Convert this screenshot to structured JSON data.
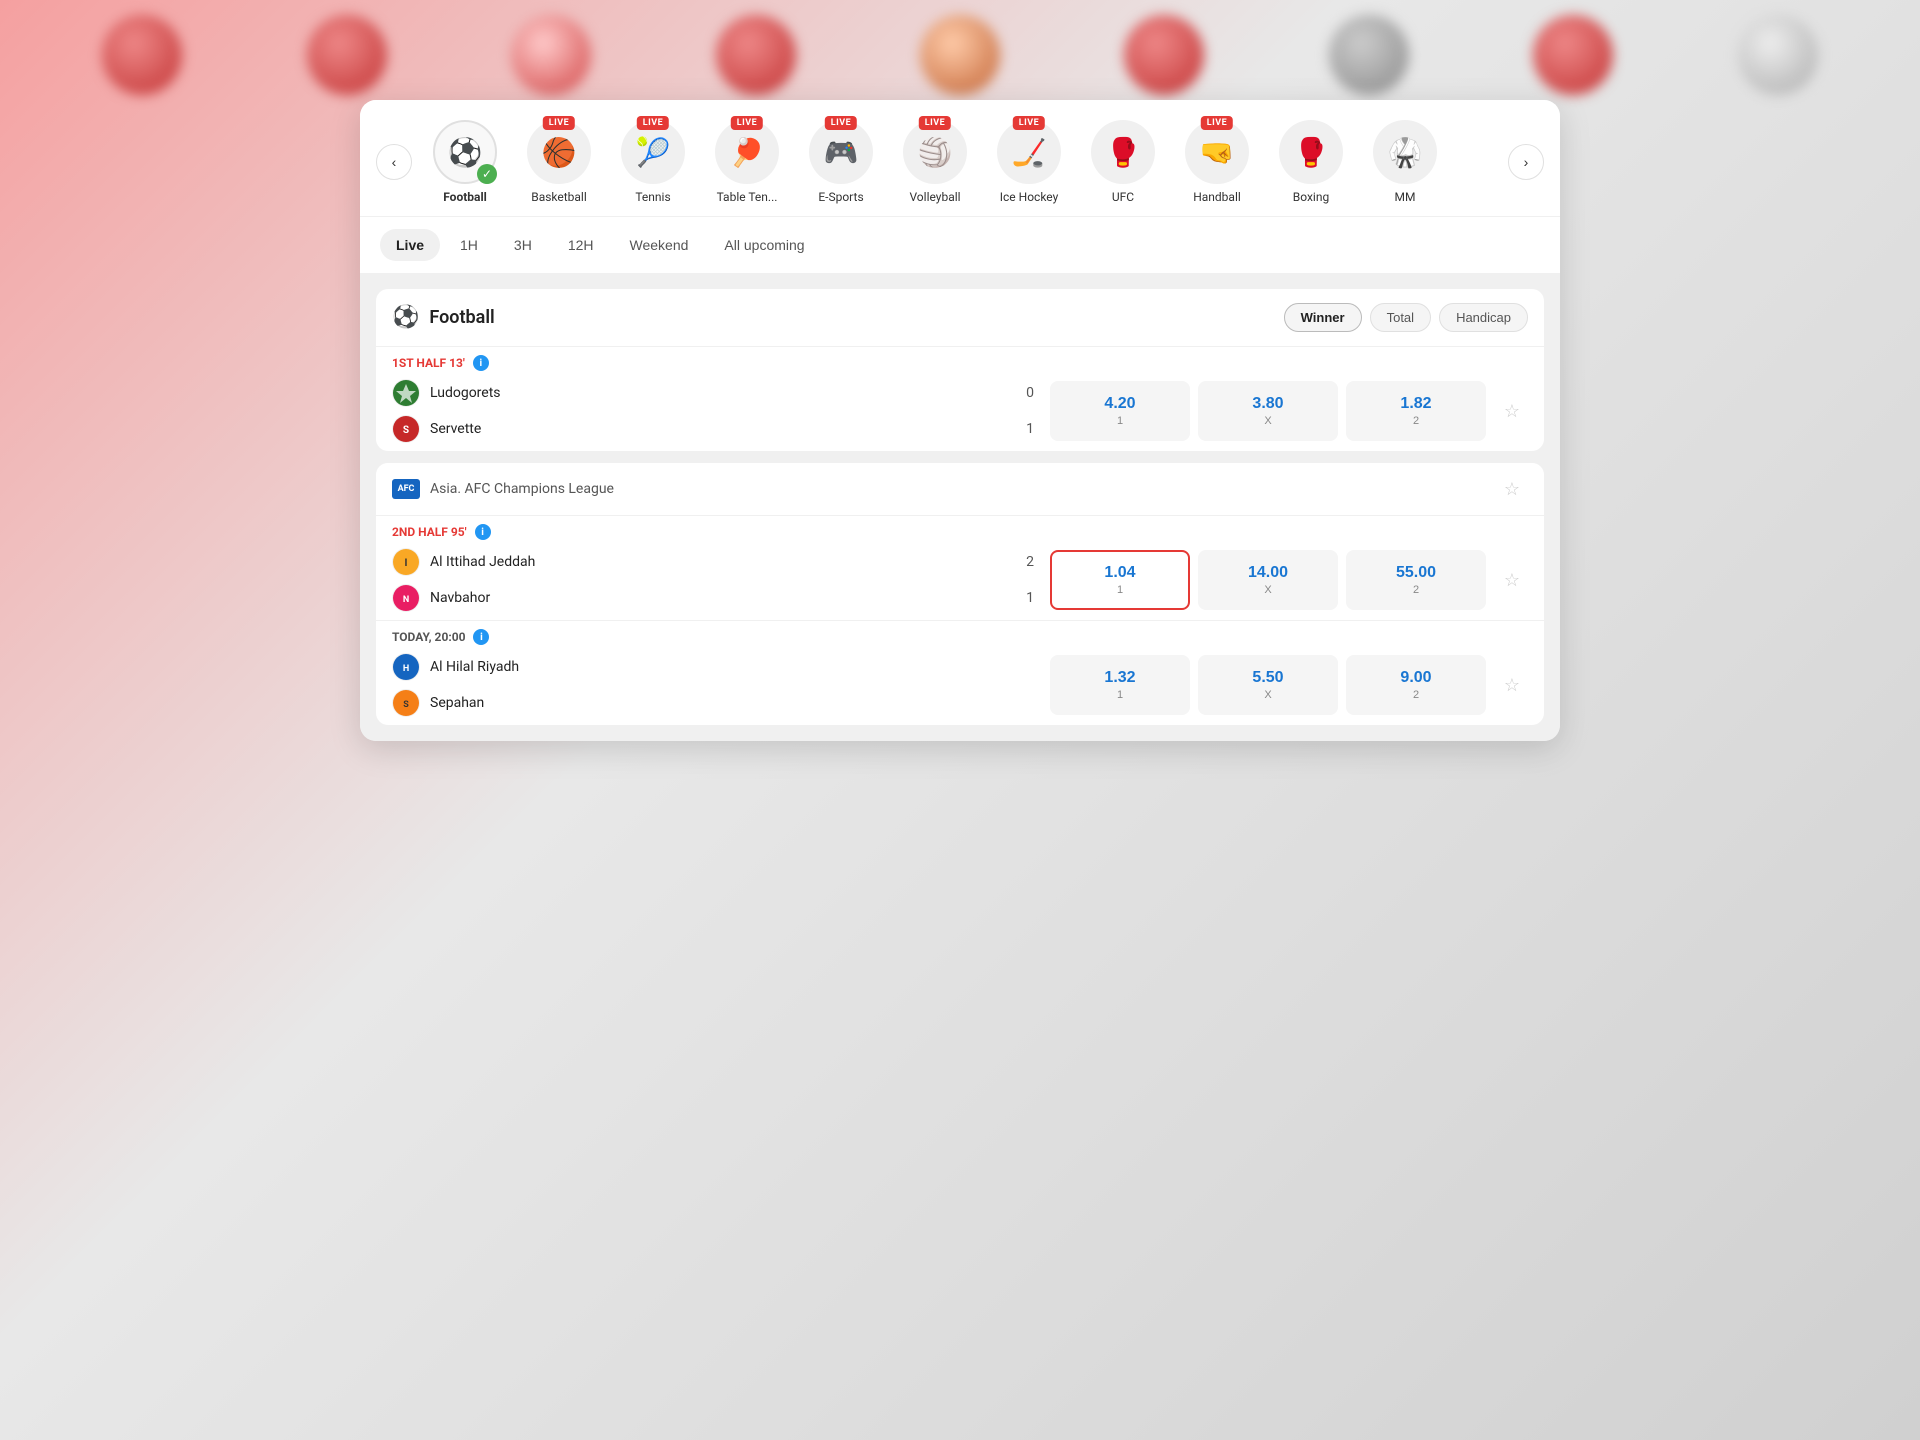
{
  "nav": {
    "prev_label": "‹",
    "next_label": "›",
    "sports": [
      {
        "id": "football",
        "label": "Football",
        "emoji": "⚽",
        "live": false,
        "active": true
      },
      {
        "id": "basketball",
        "label": "Basketball",
        "emoji": "🏀",
        "live": true,
        "active": false
      },
      {
        "id": "tennis",
        "label": "Tennis",
        "emoji": "🎾",
        "live": true,
        "active": false
      },
      {
        "id": "table-tennis",
        "label": "Table Ten...",
        "emoji": "🏓",
        "live": true,
        "active": false
      },
      {
        "id": "esports",
        "label": "E-Sports",
        "emoji": "🎮",
        "live": true,
        "active": false
      },
      {
        "id": "volleyball",
        "label": "Volleyball",
        "emoji": "🏐",
        "live": true,
        "active": false
      },
      {
        "id": "ice-hockey",
        "label": "Ice Hockey",
        "emoji": "🏒",
        "live": true,
        "active": false
      },
      {
        "id": "ufc",
        "label": "UFC",
        "emoji": "🥊",
        "live": false,
        "active": false
      },
      {
        "id": "handball",
        "label": "Handball",
        "emoji": "🤜",
        "live": true,
        "active": false
      },
      {
        "id": "boxing",
        "label": "Boxing",
        "emoji": "🥊",
        "live": false,
        "active": false
      },
      {
        "id": "mma",
        "label": "MM",
        "emoji": "🥋",
        "live": false,
        "active": false
      }
    ]
  },
  "time_filters": [
    {
      "id": "live",
      "label": "Live",
      "active": true
    },
    {
      "id": "1h",
      "label": "1H",
      "active": false
    },
    {
      "id": "3h",
      "label": "3H",
      "active": false
    },
    {
      "id": "12h",
      "label": "12H",
      "active": false
    },
    {
      "id": "weekend",
      "label": "Weekend",
      "active": false
    },
    {
      "id": "all",
      "label": "All upcoming",
      "active": false
    }
  ],
  "football_section": {
    "title": "Football",
    "emoji": "⚽",
    "bet_types": [
      {
        "id": "winner",
        "label": "Winner",
        "active": true
      },
      {
        "id": "total",
        "label": "Total",
        "active": false
      },
      {
        "id": "handicap",
        "label": "Handicap",
        "active": false
      }
    ],
    "matches": [
      {
        "league": null,
        "status": "1ST HALF 13'",
        "status_type": "live",
        "teams": [
          {
            "name": "Ludogorets",
            "score": "0",
            "emoji": "🛡️"
          },
          {
            "name": "Servette",
            "score": "1",
            "emoji": "🔴"
          }
        ],
        "odds": [
          {
            "value": "4.20",
            "label": "1",
            "highlighted": false
          },
          {
            "value": "3.80",
            "label": "X",
            "highlighted": false
          },
          {
            "value": "1.82",
            "label": "2",
            "highlighted": false
          }
        ]
      }
    ]
  },
  "afc_section": {
    "league": "Asia. AFC Champions League",
    "league_badge": "AFC",
    "matches": [
      {
        "status": "2ND HALF 95'",
        "status_type": "live",
        "teams": [
          {
            "name": "Al Ittihad Jeddah",
            "score": "2",
            "emoji": "🦁"
          },
          {
            "name": "Navbahor",
            "score": "1",
            "emoji": "🌸"
          }
        ],
        "odds": [
          {
            "value": "1.04",
            "label": "1",
            "highlighted": true
          },
          {
            "value": "14.00",
            "label": "X",
            "highlighted": false
          },
          {
            "value": "55.00",
            "label": "2",
            "highlighted": false
          }
        ]
      },
      {
        "status": "TODAY, 20:00",
        "status_type": "upcoming",
        "teams": [
          {
            "name": "Al Hilal Riyadh",
            "score": "",
            "emoji": "💙"
          },
          {
            "name": "Sepahan",
            "score": "",
            "emoji": "🟡"
          }
        ],
        "odds": [
          {
            "value": "1.32",
            "label": "1",
            "highlighted": false
          },
          {
            "value": "5.50",
            "label": "X",
            "highlighted": false
          },
          {
            "value": "9.00",
            "label": "2",
            "highlighted": false
          }
        ]
      }
    ]
  }
}
